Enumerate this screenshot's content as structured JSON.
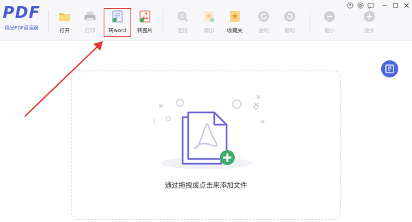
{
  "app": {
    "logo_text": "PDF",
    "logo_subtitle": "极光PDF阅读器"
  },
  "toolbar": {
    "open": "打开",
    "print": "打印",
    "to_word": "转word",
    "to_image": "转图片",
    "search": "查找",
    "add": "添加",
    "favorites": "收藏夹",
    "rotate_left": "逆时",
    "rotate_right": "顺时",
    "zoom_out": "缩小",
    "zoom_in": "放大"
  },
  "main": {
    "drop_hint": "通过拖拽或点击来添加文件"
  },
  "colors": {
    "accent": "#4b5fd3",
    "highlight_box": "#e23b32",
    "arrow": "#e23b32",
    "file_outline": "#6f67d9",
    "add_badge": "#3fae6a",
    "float_button": "#4a68d8"
  },
  "icons": {
    "open": "folder-icon",
    "print": "printer-icon",
    "to_word": "word-convert-icon",
    "to_image": "image-convert-icon",
    "search": "search-icon",
    "add": "add-bookmark-icon",
    "favorites": "favorites-icon",
    "rotate_left": "rotate-left-icon",
    "rotate_right": "rotate-right-icon",
    "zoom_out": "zoom-out-icon",
    "zoom_in": "zoom-in-icon",
    "float": "side-panel-icon"
  }
}
